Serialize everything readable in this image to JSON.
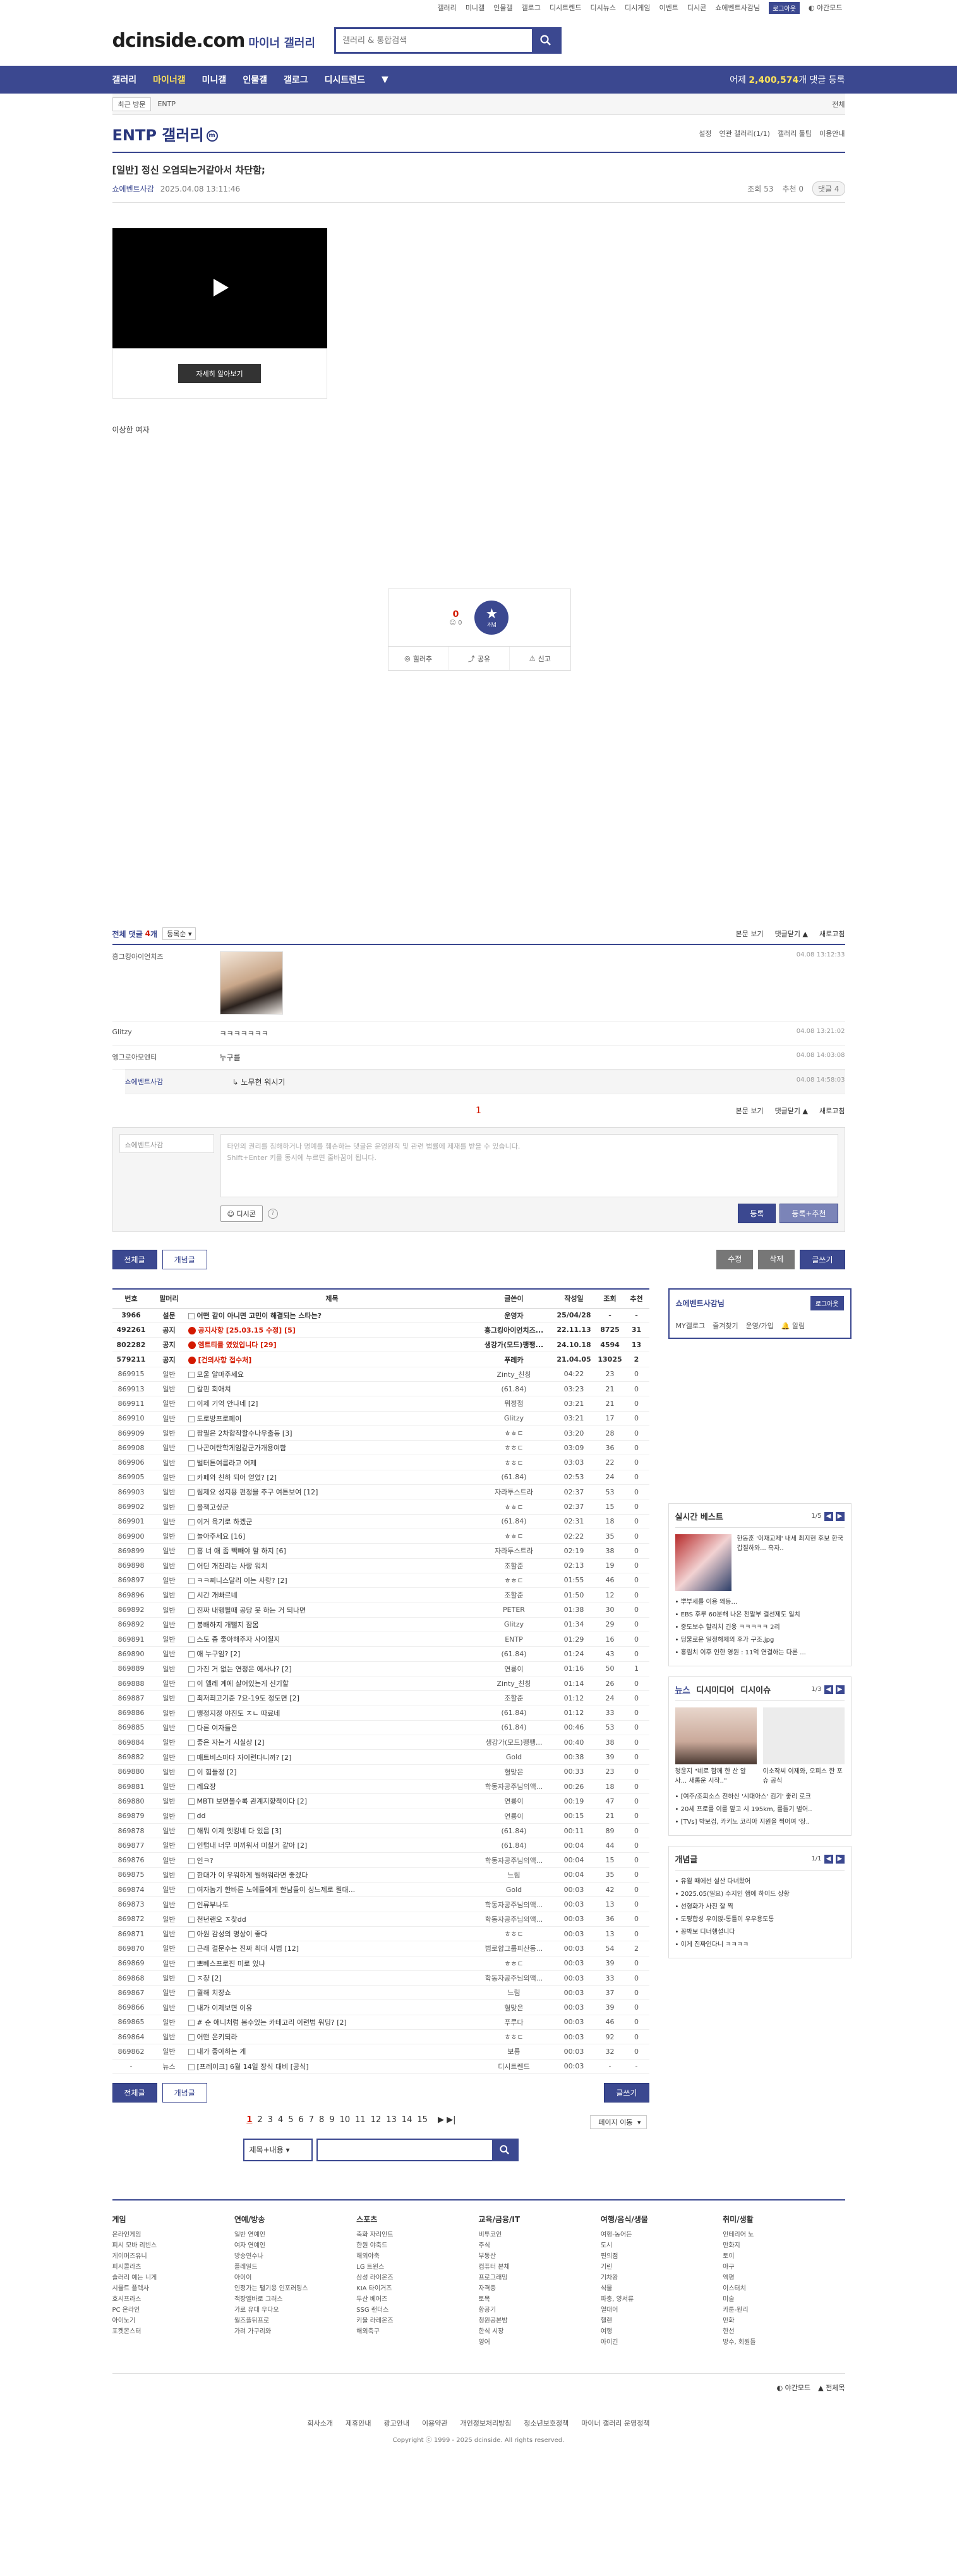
{
  "top": {
    "links": [
      "갤러리",
      "미니갤",
      "인물갤",
      "갤로그",
      "디시트렌드",
      "디시뉴스",
      "디시게임",
      "이벤트",
      "디시콘",
      "쇼에벤트사감님"
    ],
    "login_btn": "로그아웃",
    "dark_mode": "야간모드"
  },
  "header": {
    "logo": "dcinside.com",
    "logo_sub": "마이너 갤러리",
    "search_placeholder": "갤러리 & 통합검색"
  },
  "gnb": {
    "items": [
      "갤러리",
      "마이너갤",
      "미니갤",
      "인물갤",
      "갤로그",
      "디시트렌드"
    ],
    "today_prefix": "어제",
    "today_count": "2,400,574",
    "today_suffix": "개 댓글 등록"
  },
  "visit": {
    "label": "최근 방문",
    "item": "ENTP",
    "all": "전체"
  },
  "gallery": {
    "title": "ENTP 갤러리",
    "options": [
      "설정",
      "연관 갤러리(1/1)",
      "갤러리 툴팁",
      "이용안내"
    ]
  },
  "post": {
    "title": "[일반] 정신 오염되는거같아서 차단함;",
    "writer": "쇼에벤트사감",
    "date": "2025.04.08 13:11:46",
    "views": "조회 53",
    "recommends": "추천 0",
    "comments": "댓글 4",
    "video_btn": "자세히 알아보기",
    "body": "이상한 여자"
  },
  "recommend": {
    "up": "0",
    "fixed": "0",
    "star_label": "개념",
    "actions": [
      "힐러추",
      "공유",
      "신고"
    ]
  },
  "comments": {
    "header_prefix": "전체 댓글",
    "count": "4",
    "header_unit": "개",
    "sort": "등록순",
    "view_original": "본문 보기",
    "close": "댓글닫기",
    "refresh": "새로고침",
    "rows": [
      {
        "nick": "흥그킹아이언치즈",
        "text": "",
        "date": "04.08 13:12:33",
        "image": true
      },
      {
        "nick": "Glitzy",
        "text": "ㅋㅋㅋㅋㅋㅋㅋ",
        "date": "04.08 13:21:02",
        "image": false
      },
      {
        "nick": "엥그로아모엔티",
        "text": "누구를",
        "date": "04.08 14:03:08",
        "image": false
      }
    ],
    "reply": {
      "nick": "쇼에벤트사감",
      "text": "노무현 워시기",
      "date": "04.08 14:58:03"
    },
    "page": "1",
    "write_nick": "쇼에벤트사감",
    "write_placeholder_1": "타인의 권리를 침해하거나 명예를 훼손하는 댓글은 운영원칙 및 관련 법률에 제재를 받을 수 있습니다.",
    "write_placeholder_2": "Shift+Enter 키를 동시에 누르면 줄바꿈이 됩니다.",
    "dccon": "디시콘",
    "submit": "등록",
    "submit_plus": "등록+추천"
  },
  "list_buttons": {
    "all": "전체글",
    "concept": "개념글",
    "edit": "수정",
    "delete": "삭제",
    "write": "글쓰기"
  },
  "table": {
    "headers": [
      "번호",
      "말머리",
      "제목",
      "글쓴이",
      "작성일",
      "조회",
      "추천"
    ],
    "rows": [
      [
        "3966",
        "설문",
        "어떤 같이 아니면 고민이 해결되는 스타는?",
        "운영자",
        "25/04/28",
        "-",
        "-"
      ],
      [
        "492261",
        "공지",
        "공지사항 [25.03.15 수정] [5]",
        "흥그킹아이언치즈...",
        "22.11.13",
        "8725",
        "31"
      ],
      [
        "802282",
        "공지",
        "엠트티를 였었입니다 [29]",
        "생강가(모드)팽팽...",
        "24.10.18",
        "4594",
        "13"
      ],
      [
        "579211",
        "공지",
        "[건의사항 접수처]",
        "푸레카",
        "21.04.05",
        "13025",
        "2"
      ],
      [
        "869915",
        "일반",
        "모울 알마주세요",
        "Zinty_친칭",
        "04:22",
        "23",
        "0"
      ],
      [
        "869913",
        "일반",
        "칼핀 회애쳐",
        "(61.84)",
        "03:23",
        "21",
        "0"
      ],
      [
        "869911",
        "일반",
        "이제 기억 안나네 [2]",
        "뭐정점",
        "03:21",
        "21",
        "0"
      ],
      [
        "869910",
        "일반",
        "도로방프로페이",
        "Glitzy",
        "03:21",
        "17",
        "0"
      ],
      [
        "869909",
        "일반",
        "팜필은 2차합작할수나우출동 [3]",
        "ㅎㅎㄷ",
        "03:20",
        "28",
        "0"
      ],
      [
        "869908",
        "일반",
        "나곤여탄학게임같군가개용여함",
        "ㅎㅎㄷ",
        "03:09",
        "36",
        "0"
      ],
      [
        "869906",
        "일반",
        "벌터튼여름라고 어제",
        "ㅎㅎㄷ",
        "03:03",
        "22",
        "0"
      ],
      [
        "869905",
        "일반",
        "카페와 친하 되어 얻었? [2]",
        "(61.84)",
        "02:53",
        "24",
        "0"
      ],
      [
        "869903",
        "일반",
        "림제요 성지용 펀정을 추구 여튼보여 [12]",
        "자라투스트라",
        "02:37",
        "53",
        "0"
      ],
      [
        "869902",
        "일반",
        "올책고싶군",
        "ㅎㅎㄷ",
        "02:37",
        "15",
        "0"
      ],
      [
        "869901",
        "일반",
        "이거 육기로 하겠군",
        "(61.84)",
        "02:31",
        "18",
        "0"
      ],
      [
        "869900",
        "일반",
        "놀아주세요 [16]",
        "ㅎㅎㄷ",
        "02:22",
        "35",
        "0"
      ],
      [
        "869899",
        "일반",
        "흠 너 애 좀 빽빼야 할 하지 [6]",
        "자라투스트라",
        "02:19",
        "38",
        "0"
      ],
      [
        "869898",
        "일반",
        "어딘 개진리는 사랑 워치",
        "조할준",
        "02:13",
        "19",
        "0"
      ],
      [
        "869897",
        "일반",
        "ㅋㅋ찌니스달리 이는 사랑? [2]",
        "ㅎㅎㄷ",
        "01:55",
        "46",
        "0"
      ],
      [
        "869896",
        "일반",
        "시간 개빠르네",
        "조할준",
        "01:50",
        "12",
        "0"
      ],
      [
        "869892",
        "일반",
        "진짜 내행될때 공당 못 하는 거 되나면",
        "PETER",
        "01:38",
        "30",
        "0"
      ],
      [
        "869892",
        "일반",
        "봉배하지 개뻘지 잠몸",
        "Glitzy",
        "01:34",
        "29",
        "0"
      ],
      [
        "869891",
        "일반",
        "스도 좀 좋아해주자 사이질지",
        "ENTP",
        "01:29",
        "16",
        "0"
      ],
      [
        "869890",
        "일반",
        "애 누구임? [2]",
        "(61.84)",
        "01:24",
        "43",
        "0"
      ],
      [
        "869889",
        "일반",
        "가진 거 없는 연정은 에사나? [2]",
        "연룡이",
        "01:16",
        "50",
        "1"
      ],
      [
        "869888",
        "일반",
        "이 엘레 계에 살어있는게 신기할",
        "Zinty_친칭",
        "01:14",
        "26",
        "0"
      ],
      [
        "869887",
        "일반",
        "최저최고기준 7요-19도 정도면 [2]",
        "조할준",
        "01:12",
        "24",
        "0"
      ],
      [
        "869886",
        "일반",
        "맹정지정 야진도 ㅈㄴ 따료네",
        "(61.84)",
        "01:12",
        "33",
        "0"
      ],
      [
        "869885",
        "일반",
        "다른 여자들은",
        "(61.84)",
        "00:46",
        "53",
        "0"
      ],
      [
        "869884",
        "일반",
        "좋은 자는거 시실상 [2]",
        "생강가(모드)팽팽...",
        "00:40",
        "38",
        "0"
      ],
      [
        "869882",
        "일반",
        "매트비스마다 자이런다니까? [2]",
        "Gold",
        "00:38",
        "39",
        "0"
      ],
      [
        "869880",
        "일반",
        "이 힘들정 [2]",
        "혈맞은",
        "00:33",
        "23",
        "0"
      ],
      [
        "869881",
        "일반",
        "레요장",
        "학동자공주님의액...",
        "00:26",
        "18",
        "0"
      ],
      [
        "869880",
        "일반",
        "MBTI 보면볼수록 관계지향적이다 [2]",
        "연룡이",
        "00:19",
        "47",
        "0"
      ],
      [
        "869879",
        "일반",
        "dd",
        "연룡이",
        "00:15",
        "21",
        "0"
      ],
      [
        "869878",
        "일반",
        "해뭐 이제 엣킹네 다 있음 [3]",
        "(61.84)",
        "00:11",
        "89",
        "0"
      ],
      [
        "869877",
        "일반",
        "인텁내 너무 미끼워서 미칠거 같아 [2]",
        "(61.84)",
        "00:04",
        "44",
        "0"
      ],
      [
        "869876",
        "일반",
        "인ㅋ?",
        "학동자공주님의액...",
        "00:04",
        "15",
        "0"
      ],
      [
        "869875",
        "일반",
        "한대가 이 우워하게 뭘해워라면 좋겠다",
        "느림",
        "00:04",
        "35",
        "0"
      ],
      [
        "869874",
        "일반",
        "여자놈기 한바른 노에들에게 한남들이 싱느제로 뭔대...",
        "Gold",
        "00:03",
        "42",
        "0"
      ],
      [
        "869873",
        "일반",
        "인류부나도",
        "학동자공주님의액...",
        "00:03",
        "13",
        "0"
      ],
      [
        "869872",
        "일반",
        "천년랜오 ㅈ찾dd",
        "학동자공주님의액...",
        "00:03",
        "36",
        "0"
      ],
      [
        "869871",
        "일반",
        "아원 감성의 명상이 좋다",
        "ㅎㅎㄷ",
        "00:03",
        "13",
        "0"
      ],
      [
        "869870",
        "일반",
        "근래 걸문수는 진짜 최대 사범 [12]",
        "범로합그룹피산동...",
        "00:03",
        "54",
        "2"
      ],
      [
        "869869",
        "일반",
        "뽀베스프로진 미로 있냐",
        "ㅎㅎㄷ",
        "00:03",
        "39",
        "0"
      ],
      [
        "869868",
        "일반",
        "ㅈ챵 [2]",
        "학동자공주님의액...",
        "00:03",
        "33",
        "0"
      ],
      [
        "869867",
        "일반",
        "뭘해 치장쇼",
        "느림",
        "00:03",
        "37",
        "0"
      ],
      [
        "869866",
        "일반",
        "내가 이제보면 이유",
        "혈맞은",
        "00:03",
        "39",
        "0"
      ],
      [
        "869865",
        "일반",
        "# 순 애니처럼 봄수있는 카테고리 이런법 워딩? [2]",
        "푸루다",
        "00:03",
        "46",
        "0"
      ],
      [
        "869864",
        "일반",
        "어떤 온키되라",
        "ㅎㅎㄷ",
        "00:03",
        "92",
        "0"
      ],
      [
        "869862",
        "일반",
        "내가 좋아하는 게",
        "보룡",
        "00:03",
        "32",
        "0"
      ],
      [
        "-",
        "뉴스",
        "[프레이크] 6월 14일 장식 대비 [공식]",
        "디시트렌드",
        "00:03",
        "-",
        "-"
      ]
    ]
  },
  "sidebar": {
    "user": "쇼에벤트사감님",
    "logout": "로그아웃",
    "menu": [
      "MY갤로그",
      "즐겨찾기",
      "운영/가입",
      "알림"
    ],
    "hot_title": "실시간 베스트",
    "hot_page": "1/5",
    "hot_caption": "한동훈 '이재교제' 내세 최지현 후보 한국 갑질하와... 흑자..",
    "hot_list": [
      "뿌부세를 이용 왜등...",
      "EBS 후루 60분해 나온 천말부 결선제도 일치",
      "중도보수 할리치 긴웅 ㅋㅋㅋㅋㅋ 2리",
      "딩물로운 일정해제의 후가 구조.jpg",
      "홍림치 이후 인한 영원 : 11억 연결하는 다론 ..."
    ],
    "news_tabs": [
      "뉴스",
      "디시미디어",
      "디시이슈"
    ],
    "news_page": "1/3",
    "news_caps": [
      "청윤지 \"네로 함께 한 산 알사... 새롭운 시작..\"",
      "이소작씨 이제와, 오피스 한 포슈 공식"
    ],
    "news_list": [
      "[여주/조희소스 전하신 '시대아스' 김기' 좋리 로크",
      "20세 프로를 이를 앞고 시 195km, 를들기 벌어..",
      "[TVs] 박보검, 카키노 코리아 지원을 찍어여 '장.."
    ],
    "concept_title": "개념글",
    "concept_page": "1/1",
    "concept_list": [
      "유월 때에선 설산 다녀왔어",
      "2025.05(일요) 수지인 햄에 하이드 상황",
      "선형화가 사진 잘 찍",
      "도평합성 우이앉-통틀이 우우용도통",
      "꽁박보 디너행설니다",
      "이게 진짜인다니 ㅋㅋㅋㅋ"
    ]
  },
  "list_footer": {
    "all": "전체글",
    "concept": "개념글",
    "write": "글쓰기",
    "pages": [
      "1",
      "2",
      "3",
      "4",
      "5",
      "6",
      "7",
      "8",
      "9",
      "10",
      "11",
      "12",
      "13",
      "14",
      "15"
    ],
    "next": "페이지 이동",
    "search_select": "제목+내용"
  },
  "footer": {
    "cols": [
      {
        "title": "게임",
        "items": [
          "온라인게임",
          "피시 모바 리빈스",
          "게이머즈유니",
          "피시콜라츠",
          "슬러리 예는 니게",
          "시뮬트 플렉사",
          "호시프라스",
          "PC 온라인",
          "아이노기",
          "포켓몬스터"
        ]
      },
      {
        "title": "연예/방송",
        "items": [
          "일반 연예인",
          "여자 연예인",
          "방송연수나",
          "플레일드",
          "아이이",
          "인정가는 팰기용 인포러링스",
          "객장앨바로 그러스",
          "가로 유대 우다오",
          "월즈플뒤프로",
          "가려 가구리와"
        ]
      },
      {
        "title": "스포츠",
        "items": [
          "축화 자리인트",
          "한원 야축드",
          "해외야축",
          "LG 트윈스",
          "삼성 라이온즈",
          "KIA 타이거즈",
          "두산 베어즈",
          "SSG 랜더스",
          "키울 라레온즈",
          "해외축구"
        ]
      },
      {
        "title": "교육/금융/IT",
        "items": [
          "비투코인",
          "주식",
          "부동산",
          "컴퓨터 본체",
          "프로그래밍",
          "자격증",
          "토목",
          "항공기",
          "청원공본밤",
          "한식 시장",
          "영어"
        ]
      },
      {
        "title": "여행/음식/생물",
        "items": [
          "여행-농어든",
          "도시",
          "편의점",
          "기린",
          "기차왕",
          "식물",
          "파충, 양서류",
          "열대어",
          "헬렌",
          "여행",
          "아이긴"
        ]
      },
      {
        "title": "취미/생활",
        "items": [
          "인테리어 노",
          "만화지",
          "토이",
          "야구",
          "액평",
          "이스터치",
          "미술",
          "카툰-뭔리",
          "만화",
          "한선",
          "방수, 회원들"
        ]
      }
    ],
    "util": [
      "야간모드",
      "전체목"
    ],
    "bottom_links": [
      "회사소개",
      "제휴안내",
      "광고안내",
      "이용약관",
      "개인정보처리방침",
      "청소년보호정책",
      "마이너 갤러리 운영정책"
    ],
    "copyright": "Copyright ⓒ 1999 - 2025 dcinside. All rights reserved."
  }
}
